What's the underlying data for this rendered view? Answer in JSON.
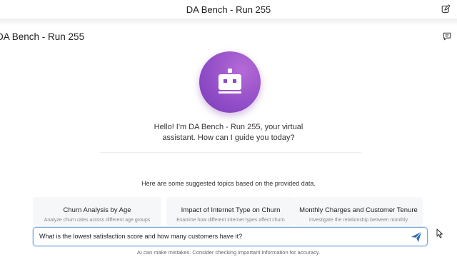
{
  "topbar": {
    "title": "DA Bench - Run 255"
  },
  "page": {
    "title": "DA Bench - Run 255"
  },
  "assistant": {
    "greeting_line1": "Hello! I'm DA Bench - Run 255, your virtual",
    "greeting_line2": "assistant. How can I guide you today?"
  },
  "suggestions": {
    "intro": "Here are some suggested topics based on the provided data.",
    "cards": [
      {
        "title": "Churn Analysis by Age",
        "description": "Analyze churn rates across different age groups"
      },
      {
        "title": "Impact of Internet Type on Churn",
        "description": "Examine how different internet types affect churn"
      },
      {
        "title": "Monthly Charges and Customer Tenure",
        "description": "Investigate the relationship between monthly"
      }
    ]
  },
  "input": {
    "value": "What is the lowest satisfaction score and how many customers have it?"
  },
  "footer": {
    "disclaimer": "AI can make mistakes. Consider checking important information for accuracy."
  },
  "colors": {
    "accent": "#8a48c4",
    "send": "#2f6fb5",
    "input_border": "#7aa7d6"
  }
}
